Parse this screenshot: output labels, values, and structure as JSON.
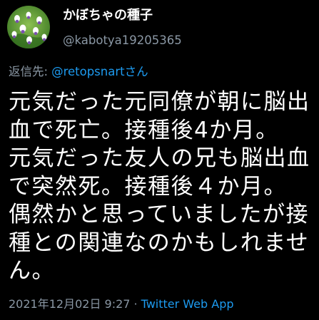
{
  "author": {
    "display_name": "かぼちゃの種子",
    "handle": "@kabotya19205365",
    "avatar_icon": "avatar-flower-field-icon"
  },
  "reply": {
    "label": "返信先:",
    "mention": "@retopsnartさん"
  },
  "tweet": {
    "lines": [
      "元気だった元同僚が朝に脳出",
      "血で死亡。接種後4か月。",
      "元気だった友人の兄も脳出血",
      "で突然死。接種後４か月。",
      "偶然かと思っていましたが接",
      "種との関連なのかもしれませ",
      "ん。"
    ]
  },
  "meta": {
    "timestamp": "2021年12月02日 9:27",
    "separator": "·",
    "source": "Twitter Web App"
  },
  "colors": {
    "background": "#000000",
    "text": "#ffffff",
    "muted": "#8b98a5",
    "accent": "#1d9bf0"
  }
}
